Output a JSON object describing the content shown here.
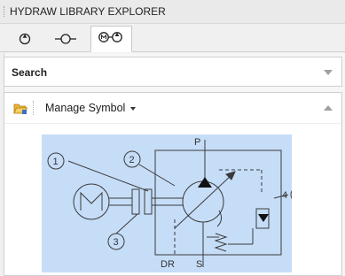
{
  "panel": {
    "title": "HYDRAW LIBRARY EXPLORER"
  },
  "tabs": [
    {
      "icon": "pump-symbol-icon",
      "active": false
    },
    {
      "icon": "line-connector-icon",
      "active": false
    },
    {
      "icon": "motor-pump-symbol-icon",
      "active": true
    }
  ],
  "search": {
    "label": "Search"
  },
  "toolbar": {
    "folder_icon": "folder-open-icon",
    "manage_label": "Manage Symbol"
  },
  "symbol": {
    "labels": {
      "one": "1",
      "two": "2",
      "three": "3",
      "four": "4",
      "p": "P",
      "dr": "DR",
      "s": "S"
    },
    "colors": {
      "tile_bg": "#c6ddf8",
      "line": "#333333"
    }
  }
}
